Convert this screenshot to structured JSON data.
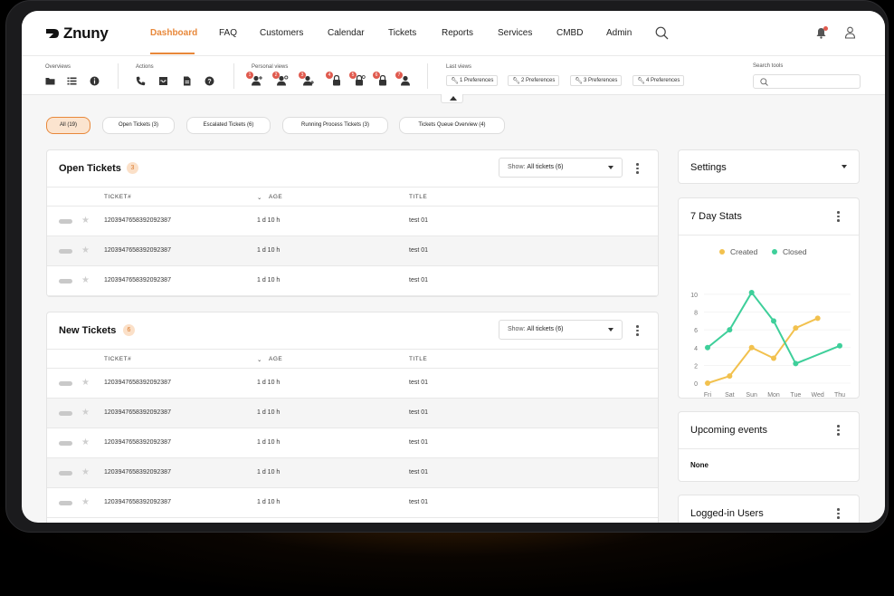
{
  "app": {
    "brand": "Znuny"
  },
  "nav": {
    "items": [
      "Dashboard",
      "FAQ",
      "Customers",
      "Calendar",
      "Tickets",
      "Reports",
      "Services",
      "CMBD",
      "Admin"
    ],
    "active": "Dashboard"
  },
  "toolbar": {
    "overviews_label": "Overviews",
    "actions_label": "Actions",
    "personal_views_label": "Personal views",
    "personal_view_badges": [
      "1",
      "2",
      "3",
      "4",
      "5",
      "6",
      "7"
    ],
    "last_views_label": "Last views",
    "last_views": [
      "1 Preferences",
      "2 Preferences",
      "3 Preferences",
      "4 Preferences"
    ],
    "search_tools_label": "Search tools"
  },
  "filters": [
    "All (19)",
    "Open Tickets (3)",
    "Escalated Tickets (6)",
    "Running Process Tickets (3)",
    "Tickets Queue Overview (4)"
  ],
  "open_tickets": {
    "title": "Open Tickets",
    "count": "3",
    "show_label": "Show:",
    "show_value": "All tickets (6)",
    "columns": [
      "TICKET#",
      "AGE",
      "TITLE"
    ],
    "rows": [
      {
        "ticket": "1203947658392092387",
        "age": "1 d 10 h",
        "title": "test 01"
      },
      {
        "ticket": "1203947658392092387",
        "age": "1 d 10 h",
        "title": "test 01"
      },
      {
        "ticket": "1203947658392092387",
        "age": "1 d 10 h",
        "title": "test 01"
      }
    ]
  },
  "new_tickets": {
    "title": "New Tickets",
    "count": "6",
    "show_label": "Show:",
    "show_value": "All tickets (6)",
    "columns": [
      "TICKET#",
      "AGE",
      "TITLE"
    ],
    "rows": [
      {
        "ticket": "1203947658392092387",
        "age": "1 d 10 h",
        "title": "test 01"
      },
      {
        "ticket": "1203947658392092387",
        "age": "1 d 10 h",
        "title": "test 01"
      },
      {
        "ticket": "1203947658392092387",
        "age": "1 d 10 h",
        "title": "test 01"
      },
      {
        "ticket": "1203947658392092387",
        "age": "1 d 10 h",
        "title": "test 01"
      },
      {
        "ticket": "1203947658392092387",
        "age": "1 d 10 h",
        "title": "test 01"
      }
    ]
  },
  "settings": {
    "title": "Settings"
  },
  "stats": {
    "title": "7 Day Stats"
  },
  "upcoming": {
    "title": "Upcoming events",
    "value": "None"
  },
  "logged_in": {
    "title": "Logged-in Users"
  },
  "colors": {
    "accent": "#e8883a",
    "created": "#f2c14e",
    "closed": "#3ecf9a",
    "badge": "#e05a4e"
  },
  "chart_data": {
    "type": "line",
    "categories": [
      "Fri",
      "Sat",
      "Sun",
      "Mon",
      "Tue",
      "Wed",
      "Thu"
    ],
    "series": [
      {
        "name": "Created",
        "values": [
          0,
          0.8,
          4,
          2.8,
          6.2,
          7.3,
          null
        ]
      },
      {
        "name": "Closed",
        "values": [
          4,
          6,
          10.2,
          7,
          2.2,
          null,
          4.2
        ]
      }
    ],
    "yticks": [
      0,
      2,
      4,
      6,
      8,
      10
    ],
    "ylim": [
      0,
      10.5
    ],
    "legend": "top",
    "grid": "horizontal"
  }
}
